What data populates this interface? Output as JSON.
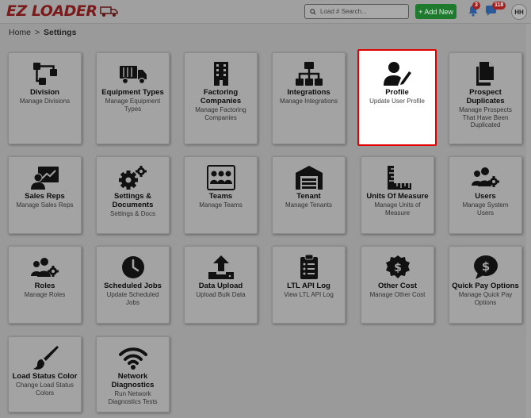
{
  "header": {
    "logo_text": "EZ LOADER",
    "search_placeholder": "Load # Search...",
    "add_button_label": "+ Add New",
    "notifications_count": "3",
    "messages_count": "118",
    "user_initials": "HH"
  },
  "breadcrumb": {
    "home": "Home",
    "separator": ">",
    "current": "Settings"
  },
  "colors": {
    "selected_border": "#e00000",
    "add_button": "#1e7b2e",
    "badge": "#a32020"
  },
  "cards": [
    {
      "icon": "division-flowchart-icon",
      "title": "Division",
      "desc": "Manage Divisions",
      "selected": false
    },
    {
      "icon": "truck-icon",
      "title": "Equipment Types",
      "desc": "Manage Equipment Types",
      "selected": false
    },
    {
      "icon": "building-icon",
      "title": "Factoring Companies",
      "desc": "Manage Factoring Companies",
      "selected": false
    },
    {
      "icon": "network-icon",
      "title": "Integrations",
      "desc": "Manage Integrations",
      "selected": false
    },
    {
      "icon": "user-pen-icon",
      "title": "Profile",
      "desc": "Update User Profile",
      "selected": true
    },
    {
      "icon": "documents-icon",
      "title": "Prospect Duplicates",
      "desc": "Manage Prospects That Have Been Duplicated",
      "selected": false
    },
    {
      "icon": "sales-rep-icon",
      "title": "Sales Reps",
      "desc": "Manage Sales Reps",
      "selected": false
    },
    {
      "icon": "gears-icon",
      "title": "Settings & Documents",
      "desc": "Settings & Docs",
      "selected": false
    },
    {
      "icon": "team-icon",
      "title": "Teams",
      "desc": "Manage Teams",
      "selected": false
    },
    {
      "icon": "warehouse-icon",
      "title": "Tenant",
      "desc": "Manage Tenants",
      "selected": false
    },
    {
      "icon": "ruler-icon",
      "title": "Units Of Measure",
      "desc": "Manage Units of Measure",
      "selected": false
    },
    {
      "icon": "users-gear-icon",
      "title": "Users",
      "desc": "Manage System Users",
      "selected": false
    },
    {
      "icon": "roles-icon",
      "title": "Roles",
      "desc": "Manage Roles",
      "selected": false
    },
    {
      "icon": "clock-icon",
      "title": "Scheduled Jobs",
      "desc": "Update Scheduled Jobs",
      "selected": false
    },
    {
      "icon": "upload-icon",
      "title": "Data Upload",
      "desc": "Upload Bulk Data",
      "selected": false
    },
    {
      "icon": "clipboard-list-icon",
      "title": "LTL API Log",
      "desc": "View LTL API Log",
      "selected": false
    },
    {
      "icon": "dollar-badge-icon",
      "title": "Other Cost",
      "desc": "Manage Other Cost",
      "selected": false
    },
    {
      "icon": "dollar-chat-icon",
      "title": "Quick Pay Options",
      "desc": "Manage Quick Pay Options",
      "selected": false
    },
    {
      "icon": "paintbrush-icon",
      "title": "Load Status Color",
      "desc": "Change Load Status Colors",
      "selected": false
    },
    {
      "icon": "wifi-icon",
      "title": "Network Diagnostics",
      "desc": "Run Network Diagnostics Tests",
      "selected": false
    }
  ]
}
